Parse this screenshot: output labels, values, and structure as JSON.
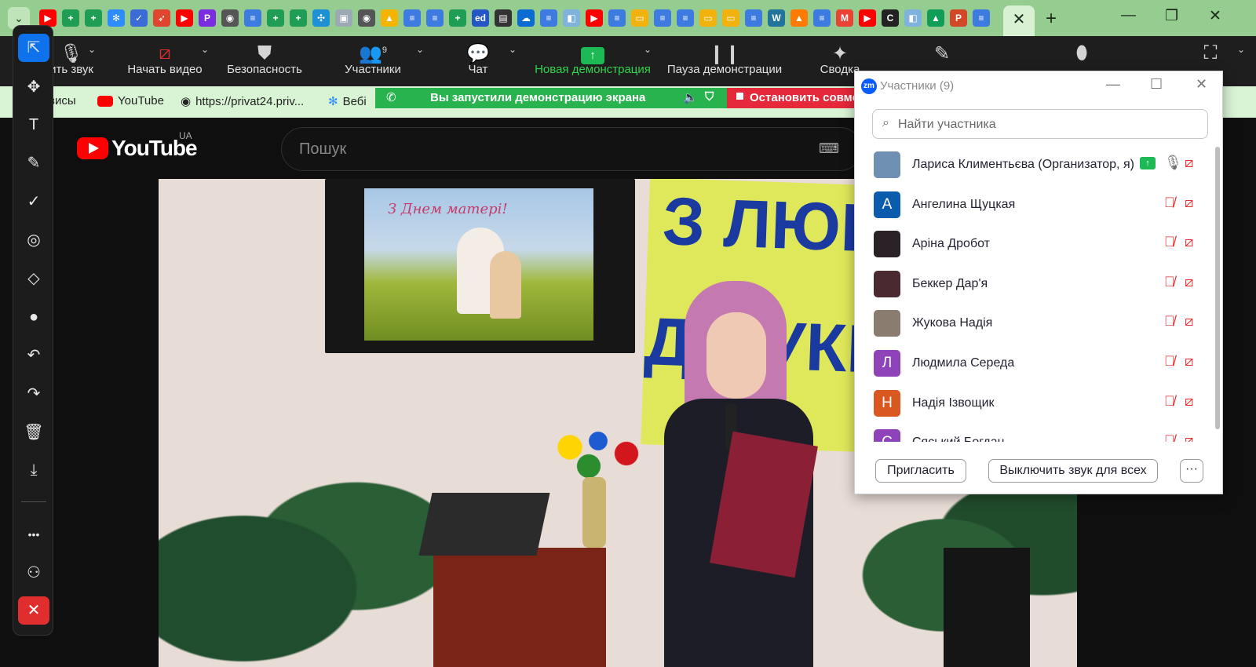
{
  "browser": {
    "tab_menu_icon": "chevron-down-icon",
    "favicons": [
      {
        "name": "youtube",
        "color": "#ff0000",
        "glyph": "▶"
      },
      {
        "name": "plus-green",
        "color": "#1f9d55",
        "glyph": "+"
      },
      {
        "name": "plus-green",
        "color": "#1f9d55",
        "glyph": "+"
      },
      {
        "name": "snowflake",
        "color": "#2d8cff",
        "glyph": "✻"
      },
      {
        "name": "chart",
        "color": "#3b6bd6",
        "glyph": "✓"
      },
      {
        "name": "app",
        "color": "#e0462e",
        "glyph": "➶"
      },
      {
        "name": "youtube",
        "color": "#ff0000",
        "glyph": "▶"
      },
      {
        "name": "app-p",
        "color": "#7b2be0",
        "glyph": "P"
      },
      {
        "name": "globe",
        "color": "#555555",
        "glyph": "◉"
      },
      {
        "name": "doc",
        "color": "#3d7be0",
        "glyph": "≡"
      },
      {
        "name": "plus-green",
        "color": "#1f9d55",
        "glyph": "+"
      },
      {
        "name": "plus-green",
        "color": "#1f9d55",
        "glyph": "+"
      },
      {
        "name": "puzzle",
        "color": "#1e90d6",
        "glyph": "✣"
      },
      {
        "name": "image",
        "color": "#9aa9b3",
        "glyph": "▣"
      },
      {
        "name": "globe",
        "color": "#555555",
        "glyph": "◉"
      },
      {
        "name": "drive",
        "color": "#f4b400",
        "glyph": "▲"
      },
      {
        "name": "doc",
        "color": "#3d7be0",
        "glyph": "≡"
      },
      {
        "name": "doc",
        "color": "#3d7be0",
        "glyph": "≡"
      },
      {
        "name": "plus-green",
        "color": "#1f9d55",
        "glyph": "+"
      },
      {
        "name": "edpuzzle",
        "color": "#2457c5",
        "glyph": "ed"
      },
      {
        "name": "contact",
        "color": "#333333",
        "glyph": "▤"
      },
      {
        "name": "onedrive",
        "color": "#0b6bd3",
        "glyph": "☁"
      },
      {
        "name": "doc",
        "color": "#3d7be0",
        "glyph": "≡"
      },
      {
        "name": "app",
        "color": "#7fb2dd",
        "glyph": "◧"
      },
      {
        "name": "youtube",
        "color": "#ff0000",
        "glyph": "▶"
      },
      {
        "name": "doc",
        "color": "#3d7be0",
        "glyph": "≡"
      },
      {
        "name": "slides",
        "color": "#f2b20e",
        "glyph": "▭"
      },
      {
        "name": "doc",
        "color": "#3d7be0",
        "glyph": "≡"
      },
      {
        "name": "doc",
        "color": "#3d7be0",
        "glyph": "≡"
      },
      {
        "name": "slides",
        "color": "#f2b20e",
        "glyph": "▭"
      },
      {
        "name": "slides",
        "color": "#f2b20e",
        "glyph": "▭"
      },
      {
        "name": "doc",
        "color": "#3d7be0",
        "glyph": "≡"
      },
      {
        "name": "wordpress",
        "color": "#21759b",
        "glyph": "W"
      },
      {
        "name": "app-orange",
        "color": "#ff7a00",
        "glyph": "▲"
      },
      {
        "name": "doc",
        "color": "#3d7be0",
        "glyph": "≡"
      },
      {
        "name": "gmail",
        "color": "#ea4335",
        "glyph": "M"
      },
      {
        "name": "youtube",
        "color": "#ff0000",
        "glyph": "▶"
      },
      {
        "name": "app-c",
        "color": "#222222",
        "glyph": "C"
      },
      {
        "name": "app",
        "color": "#7fb2dd",
        "glyph": "◧"
      },
      {
        "name": "drive",
        "color": "#0f9d58",
        "glyph": "▲"
      },
      {
        "name": "powerpoint",
        "color": "#d24726",
        "glyph": "P"
      },
      {
        "name": "doc",
        "color": "#3d7be0",
        "glyph": "≡"
      }
    ],
    "active_tab_close": "✕",
    "new_tab": "+",
    "window_controls": {
      "minimize": "—",
      "restore": "❐",
      "close": "✕"
    },
    "bookmarks": [
      {
        "label": "висы",
        "icon": ""
      },
      {
        "label": "YouTube",
        "icon": "youtube-icon"
      },
      {
        "label": "https://privat24.priv...",
        "icon": "globe-icon"
      },
      {
        "label": "Вебі",
        "icon": "snowflake-icon"
      }
    ]
  },
  "zoom_toolbar": {
    "items": [
      {
        "label": "ить звук",
        "icon": "microphone-icon"
      },
      {
        "label": "Начать видео",
        "icon": "video-off-icon"
      },
      {
        "label": "Безопасность",
        "icon": "shield-icon"
      },
      {
        "label": "Участники",
        "icon": "participants-icon",
        "count": "9"
      },
      {
        "label": "Чат",
        "icon": "chat-icon"
      },
      {
        "label": "Новая демонстрация",
        "icon": "share-screen-icon"
      },
      {
        "label": "Пауза демонстрации",
        "icon": "pause-icon"
      },
      {
        "label": "Сводка",
        "icon": "summary-icon"
      },
      {
        "label": "",
        "icon": "pencil-icon"
      },
      {
        "label": "",
        "icon": "mouse-icon"
      },
      {
        "label": "",
        "icon": "fit-screen-icon"
      }
    ],
    "accent_green": "#33d24f"
  },
  "share_bar": {
    "message": "Вы запустили демонстрацию экрана",
    "stop_label": "Остановить совместн"
  },
  "youtube": {
    "logo_text": "YouTube",
    "country_code": "UA",
    "search_placeholder": "Пошук",
    "keyboard_icon": "keyboard-icon"
  },
  "video": {
    "tv_greeting": "З Днем матері!",
    "poster_line1": "З ЛЮБ",
    "poster_line2": "ДО УКРО"
  },
  "annotation_tools": [
    {
      "name": "select-arrow-icon",
      "glyph": "⇱",
      "active": true
    },
    {
      "name": "move-icon",
      "glyph": "✥"
    },
    {
      "name": "text-icon",
      "glyph": "T"
    },
    {
      "name": "draw-pen-icon",
      "glyph": "✎"
    },
    {
      "name": "stamp-check-icon",
      "glyph": "✓"
    },
    {
      "name": "spotlight-icon",
      "glyph": "◎"
    },
    {
      "name": "eraser-icon",
      "glyph": "◇"
    },
    {
      "name": "color-dot-icon",
      "glyph": "●"
    },
    {
      "name": "undo-icon",
      "glyph": "↶"
    },
    {
      "name": "redo-icon",
      "glyph": "↷"
    },
    {
      "name": "trash-icon",
      "glyph": "🗑"
    },
    {
      "name": "download-icon",
      "glyph": "⤓"
    },
    {
      "name": "more-icon",
      "glyph": "•••"
    },
    {
      "name": "participant-annotate-icon",
      "glyph": "⚇"
    },
    {
      "name": "close-annotation-icon",
      "glyph": "✕",
      "danger": true
    }
  ],
  "participants_panel": {
    "title": "Участники (9)",
    "logo": "zm",
    "search_placeholder": "Найти участника",
    "participants": [
      {
        "name": "Лариса Климентьєва (Организатор, я)",
        "avatar": "",
        "avatar_color": "#6f8fb3",
        "sharing": true,
        "mic_muted": false,
        "cam_off": true
      },
      {
        "name": "Ангелина Щуцкая",
        "avatar": "А",
        "avatar_color": "#0b5cad",
        "sharing": false,
        "mic_muted": true,
        "cam_off": true
      },
      {
        "name": "Аріна Дробот",
        "avatar": "",
        "avatar_color": "#2a2226",
        "sharing": false,
        "mic_muted": true,
        "cam_off": true
      },
      {
        "name": "Беккер Дар'я",
        "avatar": "",
        "avatar_color": "#4a2a30",
        "sharing": false,
        "mic_muted": true,
        "cam_off": true
      },
      {
        "name": "Жукова Надія",
        "avatar": "",
        "avatar_color": "#8a7d6f",
        "sharing": false,
        "mic_muted": true,
        "cam_off": true
      },
      {
        "name": "Людмила Середа",
        "avatar": "Л",
        "avatar_color": "#8e44b8",
        "sharing": false,
        "mic_muted": true,
        "cam_off": true
      },
      {
        "name": "Надія Ізвощик",
        "avatar": "Н",
        "avatar_color": "#d9581f",
        "sharing": false,
        "mic_muted": true,
        "cam_off": true
      },
      {
        "name": "Сяський Богдан",
        "avatar": "С",
        "avatar_color": "#8e44b8",
        "sharing": false,
        "mic_muted": true,
        "cam_off": true
      }
    ],
    "invite_label": "Пригласить",
    "mute_all_label": "Выключить звук для всех",
    "more_label": "···"
  }
}
